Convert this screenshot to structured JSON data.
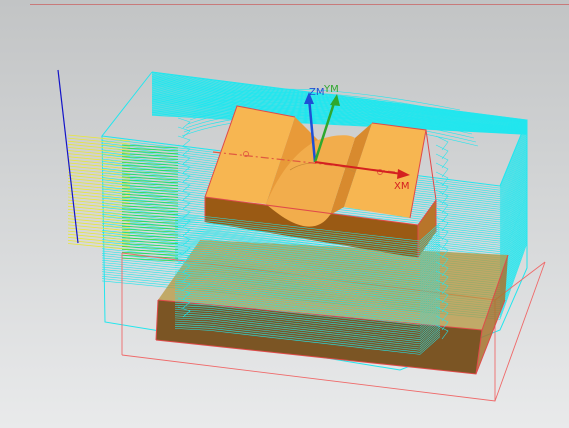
{
  "viewport": {
    "background_top": "#c2c4c5",
    "background_bottom": "#e9eaeb"
  },
  "triad": {
    "z_label": "ZM",
    "y_label": "YM",
    "x_label": "XM",
    "z_color": "#1e4fd6",
    "y_color": "#2ea82e",
    "x_color": "#d42020"
  },
  "colors": {
    "toolpath_cut": "#22e6ee",
    "toolpath_approach": "#e8e63a",
    "toolpath_engage": "#27d94a",
    "part_face": "#f5b04e",
    "part_side": "#9a5a14",
    "part_edge": "#e04a4a",
    "blank_edge": "#ef6a6a",
    "tool_axis": "#1414c8"
  }
}
